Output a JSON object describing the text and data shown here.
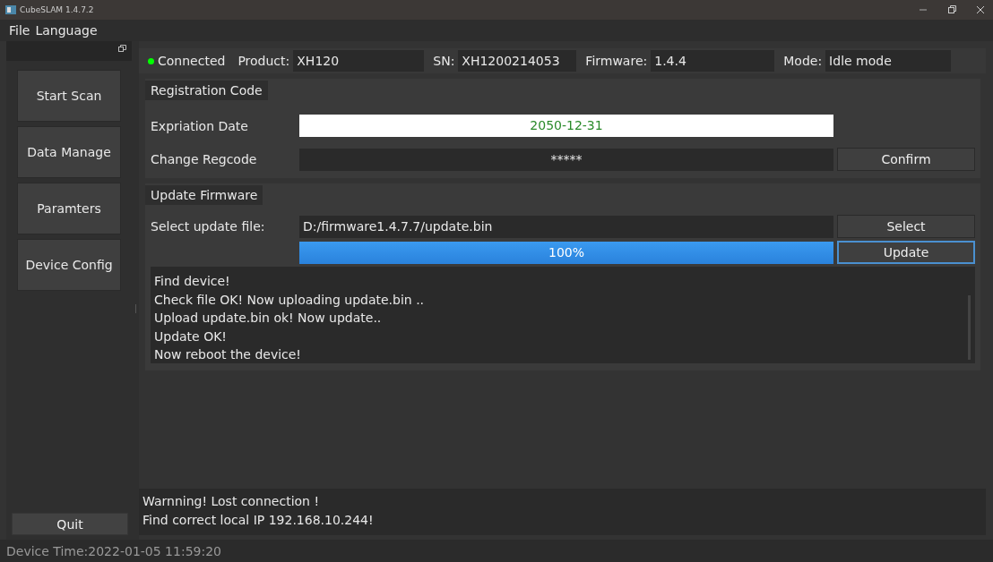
{
  "window": {
    "title": "CubeSLAM 1.4.7.2"
  },
  "menu": [
    "File",
    "Language"
  ],
  "sidebar": {
    "items": [
      {
        "label": "Start Scan"
      },
      {
        "label": "Data Manage"
      },
      {
        "label": "Paramters"
      },
      {
        "label": "Device Config"
      }
    ],
    "quit": "Quit"
  },
  "info_bar": {
    "connected": true,
    "status": "Connected",
    "fields": [
      {
        "label": "Product:",
        "value": "XH120"
      },
      {
        "label": "SN:",
        "value": "XH1200214053"
      },
      {
        "label": "Firmware:",
        "value": "1.4.4"
      },
      {
        "label": "Mode:",
        "value": "Idle mode"
      }
    ]
  },
  "registration": {
    "title": "Registration Code",
    "expiration_label": "Expriation Date",
    "expiration_value": "2050-12-31",
    "regcode_label": "Change Regcode",
    "regcode_value": "*****",
    "confirm": {
      "label": "Confirm",
      "focused": false
    }
  },
  "firmware": {
    "title": "Update Firmware",
    "file_label": "Select update file:",
    "file_value": "D:/firmware1.4.7.7/update.bin",
    "select": {
      "label": "Select",
      "focused": false
    },
    "progress": {
      "level": 1.0,
      "reading": "100%"
    },
    "update": {
      "label": "Update",
      "focused": true
    },
    "log": [
      "Find device!",
      "Check file OK! Now uploading update.bin ..",
      "Upload update.bin ok! Now update..",
      "Update OK!",
      "Now reboot the device!"
    ]
  },
  "messages": [
    "Warnning! Lost connection !",
    "Find correct local IP 192.168.10.244!"
  ],
  "status_bar": "Device Time:2022-01-05 11:59:20"
}
